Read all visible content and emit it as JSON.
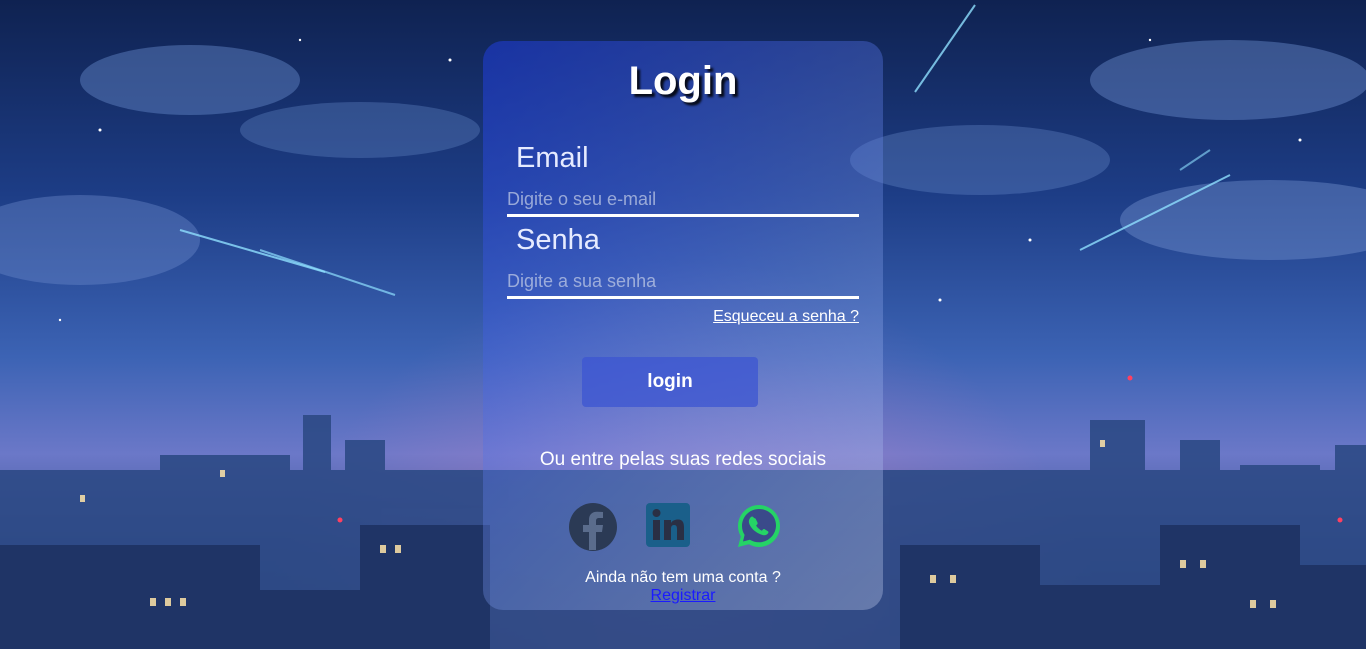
{
  "login": {
    "title": "Login",
    "email": {
      "label": "Email",
      "placeholder": "Digite o seu e-mail",
      "value": ""
    },
    "password": {
      "label": "Senha",
      "placeholder": "Digite a sua senha",
      "value": ""
    },
    "forgot_link": "Esqueceu a senha ?",
    "submit_label": "login",
    "social_prompt": "Ou entre pelas suas redes sociais",
    "social_icons": [
      "facebook-icon",
      "linkedin-icon",
      "whatsapp-icon"
    ],
    "no_account_text": "Ainda não tem uma conta ?",
    "register_link": "Registrar"
  },
  "colors": {
    "facebook": "#2b3a55",
    "linkedin": "#1a5f8a",
    "whatsapp": "#25d366",
    "register_link": "#1a1aff"
  }
}
